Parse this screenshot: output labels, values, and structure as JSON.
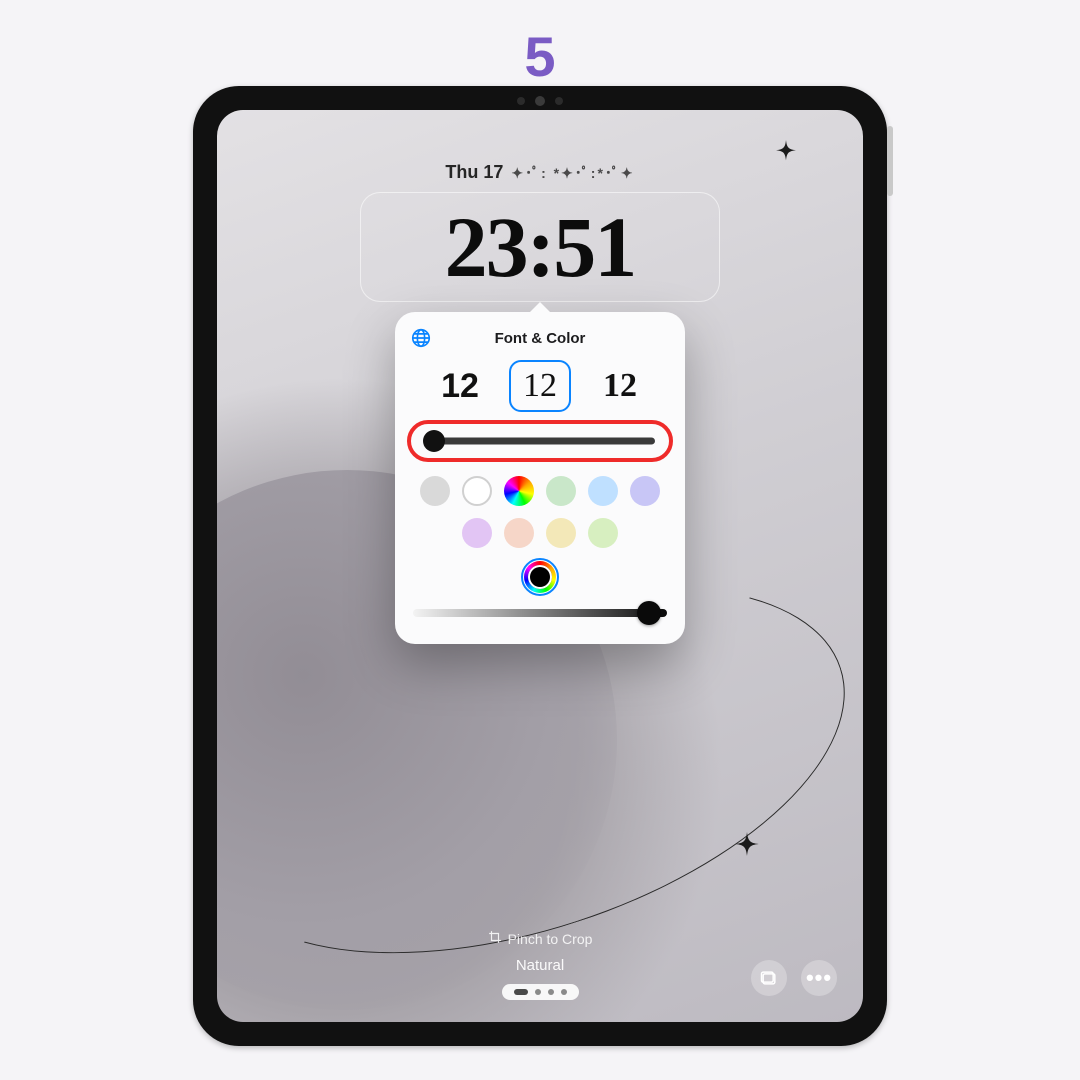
{
  "step_number": "5",
  "lockscreen": {
    "date": "Thu 17",
    "date_decoration": "✦･ﾟ: *✦･ﾟ:*･ﾟ✦",
    "time": "23:51"
  },
  "popover": {
    "title": "Font & Color",
    "font_sample": "12",
    "selected_font_index": 1,
    "weight_slider_position_pct": 6,
    "color_rows": [
      [
        "#d9d9d9",
        "#ffffff",
        "rainbow",
        "#c9e7c9",
        "#bfe0ff",
        "#c8c6f6"
      ],
      [
        "#e2c5f4",
        "#f6d6c8",
        "#f3e8b8",
        "#d7efc0"
      ]
    ],
    "selected_color_index": 10,
    "value_slider_position_pct": 93
  },
  "bottom": {
    "pinch_label": "Pinch to Crop",
    "filter_name": "Natural",
    "page_count": 4,
    "active_page": 0
  },
  "icons": {
    "globe": "globe-icon",
    "crop": "crop-icon",
    "photos": "photos-icon",
    "more": "more-icon"
  }
}
